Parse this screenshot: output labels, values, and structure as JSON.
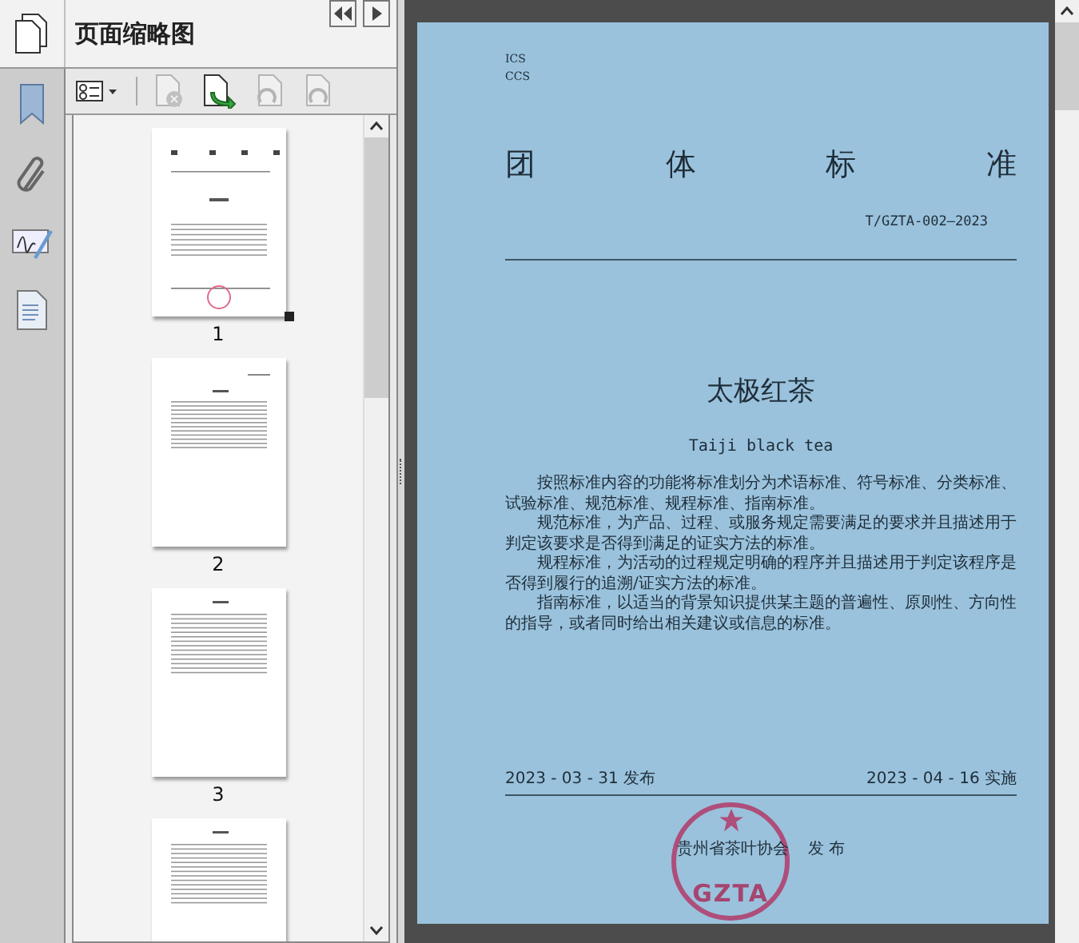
{
  "panel": {
    "title": "页面缩略图"
  },
  "toolbar": [
    {
      "kind": "options",
      "disabled": false
    },
    {
      "kind": "delete",
      "disabled": true
    },
    {
      "kind": "insert",
      "disabled": false
    },
    {
      "kind": "undo",
      "disabled": true
    },
    {
      "kind": "redo",
      "disabled": true
    }
  ],
  "thumbnails": [
    {
      "label": "1",
      "kind": "cover",
      "current": true
    },
    {
      "label": "2",
      "kind": "contents",
      "current": false
    },
    {
      "label": "3",
      "kind": "text",
      "current": false
    },
    {
      "kind": "text",
      "current": false
    }
  ],
  "document": {
    "codes": [
      "ICS",
      "CCS"
    ],
    "heading": [
      "团",
      "体",
      "标",
      "准"
    ],
    "number": "T/GZTA-002—2023",
    "title": "太极红茶",
    "subtitle": "Taiji black tea",
    "paragraphs": [
      "按照标准内容的功能将标准划分为术语标准、符号标准、分类标准、试验标准、规范标准、规程标准、指南标准。",
      "规范标准，为产品、过程、或服务规定需要满足的要求并且描述用于判定该要求是否得到满足的证实方法的标准。",
      "规程标准，为活动的过程规定明确的程序并且描述用于判定该程序是否得到履行的追溯/证实方法的标准。",
      "指南标准，以适当的背景知识提供某主题的普遍性、原则性、方向性的指导，或者同时给出相关建议或信息的标准。"
    ],
    "issue_date": "2023 - 03 - 31 发布",
    "effective_date": "2023 - 04 - 16 实施",
    "publisher": "贵州省茶叶协会",
    "publish_word": "发 布",
    "stamp_text": "GZTA"
  }
}
